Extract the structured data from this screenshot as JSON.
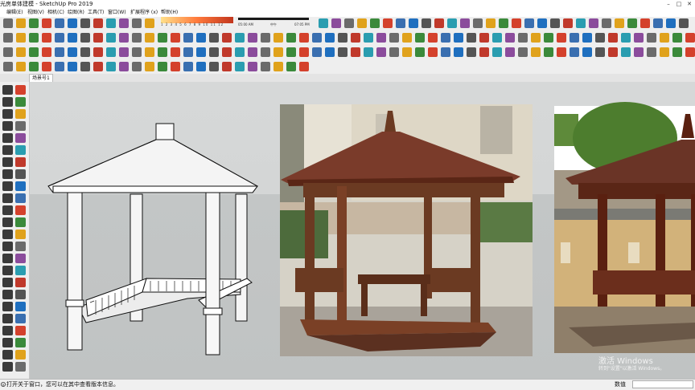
{
  "window": {
    "title": "光房单体建模 - SketchUp Pro 2019",
    "controls": [
      "minimize-icon",
      "maximize-icon",
      "close-icon"
    ]
  },
  "menubar": [
    "编辑(E)",
    "视图(V)",
    "相机(C)",
    "绘图(R)",
    "工具(T)",
    "窗口(W)",
    "扩展程序 (x)",
    "帮助(H)"
  ],
  "shadow_settings": {
    "month_labels": "1 2 3 4 5 6 7 8 9 10 11 12",
    "morning_time": "05:00 AM",
    "noon_label": "中午",
    "evening_time": "07:05 PM"
  },
  "colors": {
    "toolbar_bg": "#eeeeee",
    "sky": "#d6d8d8",
    "ground": "#c3c6c6",
    "wood": "#6b3a22",
    "roof": "#7a3b2a"
  },
  "scene_tab": "场景号1",
  "viewport": {
    "model": "white-pavilion-model",
    "reference_photos": [
      "wooden-pavilion-photo",
      "traditional-pavilion-photo"
    ]
  },
  "watermark": {
    "title": "激活 Windows",
    "subtitle": "转到\"设置\"以激活 Windows。"
  },
  "statusbar": {
    "info_icon": "info-icon",
    "message": "打开关于窗口，您可以在其中查看版本信息。",
    "measurements_label": "数值",
    "measurements_value": ""
  }
}
